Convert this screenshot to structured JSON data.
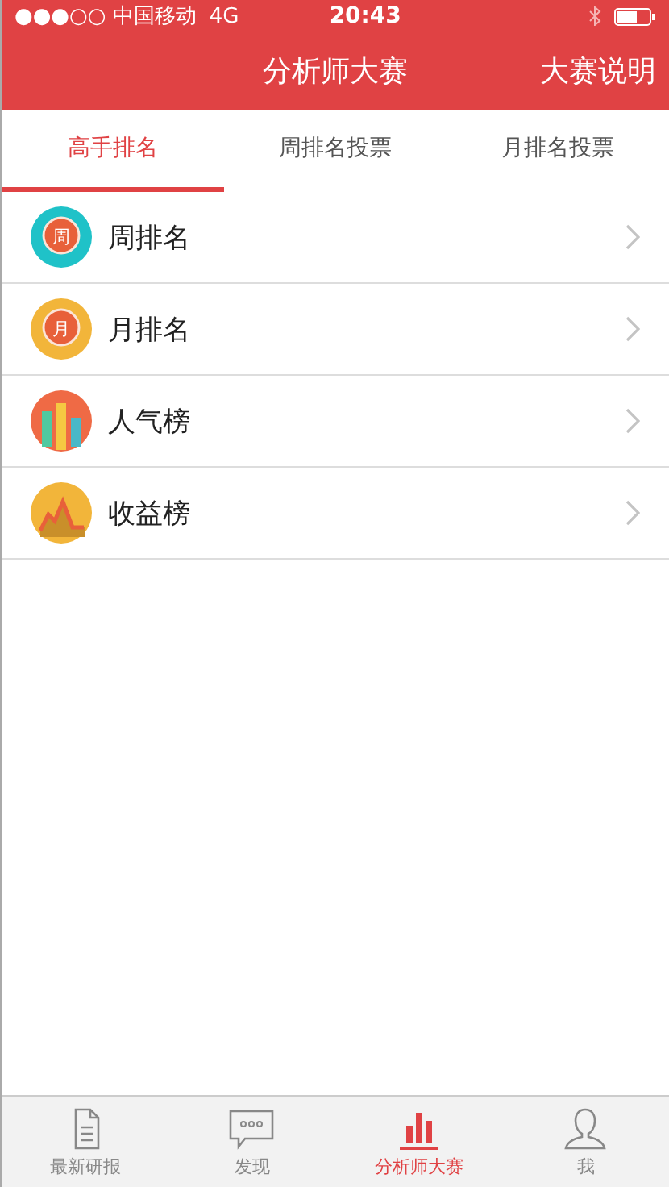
{
  "status_bar": {
    "carrier": "●●●○○ 中国移动",
    "network": "4G",
    "time": "20:43"
  },
  "nav": {
    "title": "分析师大赛",
    "action": "大赛说明"
  },
  "tabs": [
    {
      "label": "高手排名",
      "selected": true
    },
    {
      "label": "周排名投票",
      "selected": false
    },
    {
      "label": "月排名投票",
      "selected": false
    }
  ],
  "list": [
    {
      "kind": "char",
      "badge": "周",
      "color": "#1fc2c8",
      "label": "周排名"
    },
    {
      "kind": "char",
      "badge": "月",
      "color": "#f2b53a",
      "label": "月排名"
    },
    {
      "kind": "bars",
      "color": "#ef6a45",
      "label": "人气榜"
    },
    {
      "kind": "mountain",
      "color": "#f2b53a",
      "label": "收益榜"
    }
  ],
  "tab_bar": [
    {
      "kind": "doc",
      "label": "最新研报",
      "selected": false
    },
    {
      "kind": "chat",
      "label": "发现",
      "selected": false
    },
    {
      "kind": "chart",
      "label": "分析师大赛",
      "selected": true
    },
    {
      "kind": "person",
      "label": "我",
      "selected": false
    }
  ]
}
